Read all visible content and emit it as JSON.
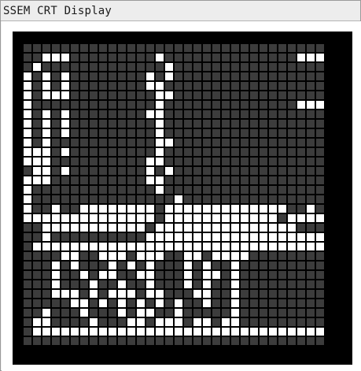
{
  "window": {
    "title": "SSEM CRT Display"
  },
  "colors": {
    "bit_on": "#ffffff",
    "bit_off": "#3c3c3c",
    "screen_background": "#000000"
  },
  "display": {
    "lines": 32,
    "bits_per_line": 32,
    "on_bits": [
      [],
      [
        2,
        3,
        4,
        14,
        29,
        30,
        31
      ],
      [
        1,
        15
      ],
      [
        0,
        2,
        4,
        13,
        15
      ],
      [
        0,
        2,
        4,
        13,
        14
      ],
      [
        0,
        2,
        3,
        4,
        14,
        15
      ],
      [
        0,
        14,
        29,
        30,
        31
      ],
      [
        0,
        2,
        4,
        13,
        14
      ],
      [
        0,
        2,
        4,
        14
      ],
      [
        0,
        2,
        4,
        14
      ],
      [
        0,
        2,
        14,
        15
      ],
      [
        0,
        1,
        2,
        4,
        14
      ],
      [
        0,
        1,
        2,
        13,
        14
      ],
      [
        1,
        2,
        4,
        13,
        15
      ],
      [
        0,
        1,
        2,
        13,
        14
      ],
      [
        0,
        14
      ],
      [
        0,
        16
      ],
      [
        0,
        3,
        6,
        7,
        8,
        9,
        10,
        11,
        12,
        13,
        15,
        16,
        17,
        18,
        19,
        20,
        21,
        22,
        23,
        24,
        25,
        26,
        27,
        30
      ],
      [
        0,
        1,
        2,
        3,
        4,
        5,
        6,
        7,
        8,
        9,
        10,
        11,
        12,
        13,
        15,
        16,
        17,
        18,
        19,
        20,
        21,
        22,
        23,
        24,
        25,
        26,
        28,
        29,
        30,
        31
      ],
      [
        2,
        3,
        4,
        5,
        6,
        7,
        8,
        9,
        10,
        11,
        12,
        14,
        15,
        16,
        17,
        18,
        19,
        20,
        21,
        22,
        23,
        24,
        25,
        26,
        27,
        28
      ],
      [
        2,
        13,
        14,
        15,
        16,
        17,
        18,
        19,
        20,
        21,
        22,
        23,
        24,
        25,
        26,
        27,
        28,
        29,
        30,
        31
      ],
      [
        1,
        2,
        3,
        4,
        5,
        6,
        7,
        8,
        9,
        10,
        11,
        12,
        13,
        14,
        15,
        16,
        17,
        18,
        19,
        20,
        21,
        22,
        23,
        24,
        25,
        26,
        27,
        28,
        29,
        30,
        31
      ],
      [
        4,
        5,
        8,
        9,
        10,
        12,
        13,
        14,
        17,
        18,
        20,
        21,
        22,
        23
      ],
      [
        3,
        5,
        9,
        11,
        13,
        17,
        19,
        22
      ],
      [
        3,
        6,
        8,
        9,
        12,
        13,
        17,
        19,
        20,
        22
      ],
      [
        3,
        7,
        10,
        13,
        17,
        19,
        22
      ],
      [
        3,
        4,
        5,
        7,
        9,
        10,
        11,
        13,
        14,
        18,
        19,
        22
      ],
      [
        5,
        6,
        8,
        10,
        12,
        14,
        16,
        19,
        22
      ],
      [
        2,
        6,
        10,
        12,
        13,
        16,
        22
      ],
      [
        1,
        2,
        7,
        11,
        12,
        14,
        15,
        16,
        18,
        19,
        21,
        22
      ],
      [
        1,
        2,
        3,
        4,
        5,
        6,
        7,
        8,
        9,
        10,
        11,
        12,
        13,
        14,
        15,
        16,
        17,
        18,
        19,
        20,
        21,
        22,
        23,
        24,
        25,
        26,
        27,
        28,
        29,
        30,
        31
      ],
      []
    ]
  }
}
